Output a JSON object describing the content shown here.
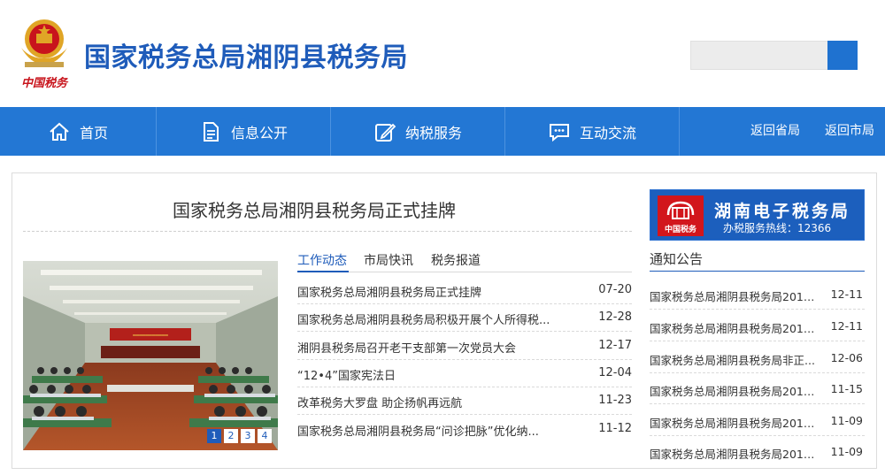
{
  "header": {
    "site_title": "国家税务总局湘阴县税务局",
    "emblem_caption": "中国税务",
    "search_placeholder": ""
  },
  "nav": {
    "items": [
      {
        "label": "首页",
        "icon": "home-icon"
      },
      {
        "label": "信息公开",
        "icon": "document-icon"
      },
      {
        "label": "纳税服务",
        "icon": "edit-icon"
      },
      {
        "label": "互动交流",
        "icon": "chat-icon"
      }
    ],
    "links": [
      "返回省局",
      "返回市局"
    ]
  },
  "main": {
    "headline": "国家税务总局湘阴县税务局正式挂牌",
    "slider": {
      "pages": [
        "1",
        "2",
        "3",
        "4"
      ],
      "active_page": 1
    },
    "tabs": [
      "工作动态",
      "市局快讯",
      "税务报道"
    ],
    "news": [
      {
        "title": "国家税务总局湘阴县税务局正式挂牌",
        "date": "07-20"
      },
      {
        "title": "国家税务总局湘阴县税务局积极开展个人所得税...",
        "date": "12-28"
      },
      {
        "title": "湘阴县税务局召开老干支部第一次党员大会",
        "date": "12-17"
      },
      {
        "title": "“12•4”国家宪法日",
        "date": "12-04"
      },
      {
        "title": "改革税务大罗盘 助企扬帆再远航",
        "date": "11-23"
      },
      {
        "title": "国家税务总局湘阴县税务局“问诊把脉”优化纳...",
        "date": "11-12"
      }
    ]
  },
  "sidebar": {
    "banner": {
      "title": "湖南电子税务局",
      "subtitle": "办税服务热线：12366",
      "logo_caption": "中国税务"
    },
    "notice_title": "通知公告",
    "notices": [
      {
        "title": "国家税务总局湘阴县税务局2018...",
        "date": "12-11"
      },
      {
        "title": "国家税务总局湘阴县税务局2018...",
        "date": "12-11"
      },
      {
        "title": "国家税务总局湘阴县税务局非正...",
        "date": "12-06"
      },
      {
        "title": "国家税务总局湘阴县税务局2018...",
        "date": "11-15"
      },
      {
        "title": "国家税务总局湘阴县税务局2018...",
        "date": "11-09"
      },
      {
        "title": "国家税务总局湘阴县税务局2018...",
        "date": "11-09"
      }
    ]
  },
  "colors": {
    "brand_blue": "#2377d4",
    "title_blue": "#1f5cba",
    "emblem_red": "#c8141c",
    "emblem_gold": "#e0a526"
  }
}
